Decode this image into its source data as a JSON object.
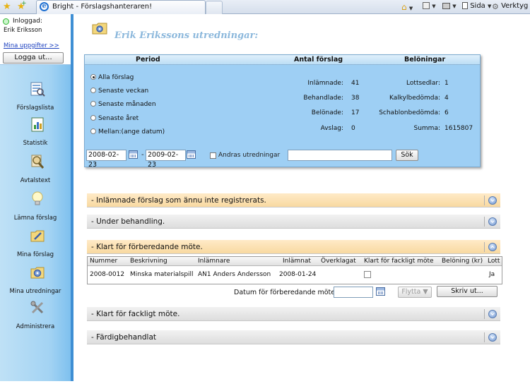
{
  "browser": {
    "tab_title": "Bright - Förslagshanteraren!",
    "sida_label": "Sida",
    "verktyg_label": "Verktyg"
  },
  "sidebar": {
    "logged_in_label": "Inloggad:",
    "user_name": "Erik Eriksson",
    "my_info_link": "Mina uppgifter >>",
    "logout_label": "Logga ut...",
    "nav": [
      {
        "label": "Förslagslista",
        "icon": "list-report-icon"
      },
      {
        "label": "Statistik",
        "icon": "statistics-icon"
      },
      {
        "label": "Avtalstext",
        "icon": "magnifier-document-icon"
      },
      {
        "label": "Lämna förslag",
        "icon": "lightbulb-icon"
      },
      {
        "label": "Mina förslag",
        "icon": "folder-pencil-icon"
      },
      {
        "label": "Mina utredningar",
        "icon": "folder-gear-icon"
      },
      {
        "label": "Administrera",
        "icon": "tools-icon"
      }
    ]
  },
  "main": {
    "title": "Erik Erikssons utredningar:",
    "panel": {
      "headers": {
        "period": "Period",
        "count": "Antal förslag",
        "rewards": "Belöningar"
      },
      "periods": [
        {
          "label": "Alla förslag",
          "checked": true
        },
        {
          "label": "Senaste veckan",
          "checked": false
        },
        {
          "label": "Senaste månaden",
          "checked": false
        },
        {
          "label": "Senaste året",
          "checked": false
        },
        {
          "label": "Mellan:(ange datum)",
          "checked": false
        }
      ],
      "counts": [
        {
          "label": "Inlämnade:",
          "value": "41"
        },
        {
          "label": "Behandlade:",
          "value": "38"
        },
        {
          "label": "Belönade:",
          "value": "17"
        },
        {
          "label": "Avslag:",
          "value": "0"
        }
      ],
      "rewards": [
        {
          "label": "Lottsedlar:",
          "value": "1"
        },
        {
          "label": "Kalkylbedömda:",
          "value": "4"
        },
        {
          "label": "Schablonbedömda:",
          "value": "6"
        },
        {
          "label": "Summa:",
          "value": "1615807"
        }
      ],
      "date_from": "2008-02-23",
      "date_separator": "-",
      "date_to": "2009-02-23",
      "others_label": "Andras utredningar",
      "search_value": "",
      "search_button": "Sök"
    },
    "sections": [
      {
        "title": "- Inlämnade förslag som ännu inte registrerats.",
        "color": "yellow",
        "expanded": false
      },
      {
        "title": "- Under behandling.",
        "color": "gray",
        "expanded": false
      },
      {
        "title": "- Klart för förberedande möte.",
        "color": "yellow",
        "expanded": true
      },
      {
        "title": "- Klart för fackligt möte.",
        "color": "gray",
        "expanded": false
      },
      {
        "title": "- Färdigbehandlat",
        "color": "gray",
        "expanded": false
      }
    ],
    "table": {
      "columns": [
        "Nummer",
        "Beskrivning",
        "Inlämnare",
        "Inlämnat",
        "Överklagat",
        "Klart för fackligt möte",
        "Belöning (kr)",
        "Lott"
      ],
      "rows": [
        {
          "nummer": "2008-0012",
          "beskrivning": "Minska materialspill",
          "inlamnare": "AN1 Anders Andersson",
          "inlamnat": "2008-01-24",
          "overklagat": "",
          "klart": false,
          "beloning": "",
          "lott": "Ja"
        }
      ]
    },
    "meeting_label": "Datum för förberedande möte:",
    "meeting_date": "",
    "move_button": "Flytta ▼",
    "print_button": "Skriv ut..."
  },
  "colors": {
    "sidebar_accent": "#3f8fd4",
    "panel_bg": "#9ecff4",
    "section_yellow": "#f8d9a1",
    "title_blue": "#8cb8dc"
  }
}
